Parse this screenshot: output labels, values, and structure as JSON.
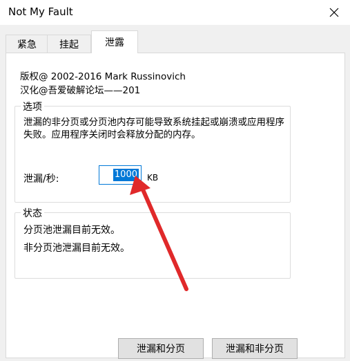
{
  "window": {
    "title": "Not My Fault",
    "close_icon": "close-icon"
  },
  "tabs": [
    {
      "label": "紧急",
      "active": false
    },
    {
      "label": "挂起",
      "active": false
    },
    {
      "label": "泄露",
      "active": true
    }
  ],
  "about": {
    "copyright": "版权@ 2002-2016 Mark Russinovich",
    "localization": "汉化@吾爱破解论坛——201"
  },
  "options": {
    "group_label": "选项",
    "description": "泄漏的非分页或分页池内存可能导致系统挂起或崩溃或应用程序失败。应用程序关闭时会释放分配的内存。",
    "leak_rate_label": "泄漏/秒:",
    "leak_rate_value": "1000",
    "unit": "KB"
  },
  "status": {
    "group_label": "状态",
    "paged_status": "分页池泄漏目前无效。",
    "nonpaged_status": "非分页池泄漏目前无效。"
  },
  "buttons": {
    "leak_paged": "泄漏和分页",
    "leak_nonpaged": "泄漏和非分页"
  },
  "colors": {
    "accent": "#0078d7",
    "arrow": "#e0292a"
  }
}
